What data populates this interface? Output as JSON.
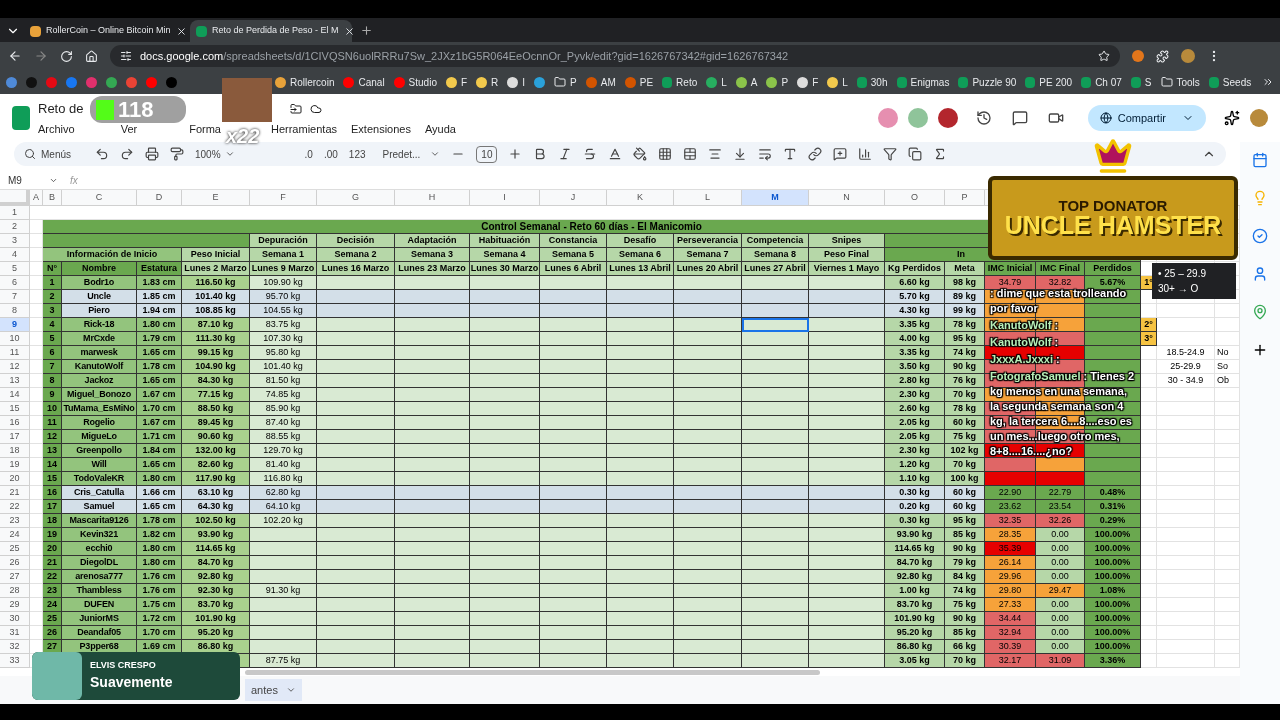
{
  "browser": {
    "tabs": [
      {
        "title": "RollerCoin – Online Bitcoin Min",
        "selected": false
      },
      {
        "title": "Reto de Perdida de Peso - El M",
        "selected": true
      }
    ],
    "url_host": "docs.google.com",
    "url_path": "/spreadsheets/d/1CIVQSN6uolRRRu7Sw_2JXz1bG5R064EeOcnnOr_Pyvk/edit?gid=1626767342#gid=1626767342",
    "bookmarks": [
      {
        "kind": "site",
        "color": "#4f8ad8"
      },
      {
        "kind": "site",
        "color": "#111111"
      },
      {
        "kind": "site",
        "color": "#e50914"
      },
      {
        "kind": "site",
        "color": "#1877f2"
      },
      {
        "kind": "site",
        "color": "#e1306c"
      },
      {
        "kind": "site",
        "color": "#34a853"
      },
      {
        "kind": "site",
        "color": "#ea4335"
      },
      {
        "kind": "site",
        "color": "#ff0000"
      },
      {
        "kind": "site",
        "color": "#000000"
      },
      {
        "kind": "gap"
      },
      {
        "kind": "site",
        "color": "#e8a23a",
        "label": "Rollercoin"
      },
      {
        "kind": "site",
        "color": "#ff0000",
        "label": "Canal"
      },
      {
        "kind": "site",
        "color": "#ff0000",
        "label": "Studio"
      },
      {
        "kind": "site",
        "color": "#f2c94c",
        "label": "F"
      },
      {
        "kind": "site",
        "color": "#f2c94c",
        "label": "R"
      },
      {
        "kind": "site",
        "color": "#dddddd",
        "label": "I"
      },
      {
        "kind": "site",
        "color": "#2aa1da"
      },
      {
        "kind": "folder",
        "label": "P"
      },
      {
        "kind": "site",
        "color": "#d35400",
        "label": "AM"
      },
      {
        "kind": "site",
        "color": "#d35400",
        "label": "PE"
      },
      {
        "kind": "sheet",
        "label": "Reto"
      },
      {
        "kind": "site",
        "color": "#27ae60",
        "label": "L"
      },
      {
        "kind": "site",
        "color": "#8bc34a",
        "label": "A"
      },
      {
        "kind": "site",
        "color": "#8bc34a",
        "label": "P"
      },
      {
        "kind": "site",
        "color": "#dddddd",
        "label": "F"
      },
      {
        "kind": "site",
        "color": "#f2c94c",
        "label": "L"
      },
      {
        "kind": "sheet",
        "label": "30h"
      },
      {
        "kind": "sheet",
        "label": "Enigmas"
      },
      {
        "kind": "sheet",
        "label": "Puzzle 90"
      },
      {
        "kind": "sheet",
        "label": "PE 200"
      },
      {
        "kind": "sheet",
        "label": "Ch 07"
      },
      {
        "kind": "sheet",
        "label": "S"
      },
      {
        "kind": "folder",
        "label": "Tools"
      },
      {
        "kind": "sheet",
        "label": "Seeds"
      }
    ]
  },
  "doc": {
    "title": "Reto de",
    "menu": [
      "Archivo",
      "Ver",
      "Forma",
      "Herramientas",
      "Extensiones",
      "Ayuda"
    ],
    "collaborators": [
      {
        "color": "#e68fb0"
      },
      {
        "color": "#8fc49a"
      },
      {
        "color": "#b3262d"
      }
    ],
    "share": "Compartir"
  },
  "toolbar": {
    "search": "Menús",
    "zoom": "100%",
    "decimals": [
      ".0",
      ".00",
      "123"
    ],
    "font": "Predet...",
    "font_size": "10"
  },
  "formula_bar": {
    "cell": "M9",
    "fx": "fx"
  },
  "columns": [
    {
      "label": "A",
      "selected": false
    },
    {
      "label": "B",
      "selected": false
    },
    {
      "label": "C",
      "selected": false
    },
    {
      "label": "D",
      "selected": false
    },
    {
      "label": "E",
      "selected": false
    },
    {
      "label": "F",
      "selected": false
    },
    {
      "label": "G",
      "selected": false
    },
    {
      "label": "H",
      "selected": false
    },
    {
      "label": "I",
      "selected": false
    },
    {
      "label": "J",
      "selected": false
    },
    {
      "label": "K",
      "selected": false
    },
    {
      "label": "L",
      "selected": false
    },
    {
      "label": "M",
      "selected": true
    },
    {
      "label": "N",
      "selected": false
    },
    {
      "label": "O",
      "selected": false
    },
    {
      "label": "P",
      "selected": false
    }
  ],
  "row_numbers": [
    {
      "label": "1",
      "selected": false
    },
    {
      "label": "2",
      "selected": false
    },
    {
      "label": "3",
      "selected": false
    },
    {
      "label": "4",
      "selected": false
    },
    {
      "label": "5",
      "selected": false
    },
    {
      "label": "6",
      "selected": false
    },
    {
      "label": "7",
      "selected": false
    },
    {
      "label": "8",
      "selected": false
    },
    {
      "label": "9",
      "selected": true
    },
    {
      "label": "10",
      "selected": false
    },
    {
      "label": "11",
      "selected": false
    },
    {
      "label": "12",
      "selected": false
    },
    {
      "label": "13",
      "selected": false
    },
    {
      "label": "14",
      "selected": false
    },
    {
      "label": "15",
      "selected": false
    },
    {
      "label": "16",
      "selected": false
    },
    {
      "label": "17",
      "selected": false
    },
    {
      "label": "18",
      "selected": false
    },
    {
      "label": "19",
      "selected": false
    },
    {
      "label": "20",
      "selected": false
    },
    {
      "label": "21",
      "selected": false
    },
    {
      "label": "22",
      "selected": false
    },
    {
      "label": "23",
      "selected": false
    },
    {
      "label": "24",
      "selected": false
    },
    {
      "label": "25",
      "selected": false
    },
    {
      "label": "26",
      "selected": false
    },
    {
      "label": "27",
      "selected": false
    },
    {
      "label": "28",
      "selected": false
    },
    {
      "label": "29",
      "selected": false
    },
    {
      "label": "30",
      "selected": false
    },
    {
      "label": "31",
      "selected": false
    },
    {
      "label": "32",
      "selected": false
    },
    {
      "label": "33",
      "selected": false
    }
  ],
  "sheet": {
    "title": "Control Semanal - Reto 60 días - El Manicomio",
    "phases": [
      "Depuración",
      "Decisión",
      "Adaptación",
      "Habituación",
      "Constancia",
      "Desafío",
      "Perseverancia",
      "Competencia",
      "Snipes"
    ],
    "start_group": "Información de Inicio",
    "start_weight": "Peso Inicial",
    "weeks": [
      "Semana 1",
      "Semana 2",
      "Semana 3",
      "Semana 4",
      "Semana 5",
      "Semana 6",
      "Semana 7",
      "Semana 8",
      "Peso Final"
    ],
    "final_group": "In",
    "headers": [
      "N°",
      "Nombre",
      "Estatura",
      "Lunes 2 Marzo",
      "Lunes 9 Marzo",
      "Lunes 16 Marzo",
      "Lunes 23 Marzo",
      "Lunes 30 Marzo",
      "Lunes 6 Abril",
      "Lunes 13 Abril",
      "Lunes 20 Abril",
      "Lunes 27 Abril",
      "Viernes 1 Mayo",
      "Kg Perdidos",
      "Meta",
      "IMC Inicial",
      "IMC Final",
      "Perdidos"
    ],
    "participants": [
      {
        "no": "1",
        "name": "Bodr1o",
        "height": "1.83 cm",
        "start": "116.50 kg",
        "week1": "109.90 kg",
        "lost": "6.60 kg",
        "goal": "98 kg",
        "bmi_start": {
          "value": "34.79",
          "color": "#e06666"
        },
        "bmi_end": {
          "value": "32.82",
          "color": "#e06666"
        },
        "percent": {
          "value": "5.67%",
          "color": "#6aa84f"
        },
        "highlighted": false,
        "rank": "1°"
      },
      {
        "no": "2",
        "name": "Uncle",
        "height": "1.85 cm",
        "start": "101.40 kg",
        "week1": "95.70 kg",
        "lost": "5.70 kg",
        "goal": "89 kg",
        "bmi_start": {
          "color": "#f6a23a"
        },
        "bmi_end": {
          "color": "#f6a23a"
        },
        "percent": {
          "color": "#6aa84f"
        },
        "highlighted": true
      },
      {
        "no": "3",
        "name": "Piero",
        "height": "1.94 cm",
        "start": "108.85 kg",
        "week1": "104.55 kg",
        "lost": "4.30 kg",
        "goal": "99 kg",
        "bmi_start": {
          "color": "#f6a23a"
        },
        "bmi_end": {
          "color": "#f6a23a"
        },
        "percent": {
          "color": "#6aa84f"
        },
        "highlighted": true
      },
      {
        "no": "4",
        "name": "Rick-18",
        "height": "1.80 cm",
        "start": "87.10 kg",
        "week1": "83.75 kg",
        "lost": "3.35 kg",
        "goal": "78 kg",
        "bmi_start": {
          "color": "#f6a23a"
        },
        "bmi_end": {
          "color": "#f6a23a"
        },
        "percent": {
          "color": "#6aa84f"
        },
        "highlighted": false,
        "rank": "2°"
      },
      {
        "no": "5",
        "name": "MrCxde",
        "height": "1.79 cm",
        "start": "111.30 kg",
        "week1": "107.30 kg",
        "lost": "4.00 kg",
        "goal": "95 kg",
        "bmi_start": {
          "color": "#e06666"
        },
        "bmi_end": {
          "color": "#e06666"
        },
        "percent": {
          "color": "#6aa84f"
        },
        "highlighted": false,
        "rank": "3°"
      },
      {
        "no": "6",
        "name": "marwesk",
        "height": "1.65 cm",
        "start": "99.15 kg",
        "week1": "95.80 kg",
        "lost": "3.35 kg",
        "goal": "74 kg",
        "bmi_start": {
          "color": "#e60000"
        },
        "bmi_end": {
          "color": "#e60000"
        },
        "percent": {
          "color": "#6aa84f"
        },
        "highlighted": false
      },
      {
        "no": "7",
        "name": "KanutoWolf",
        "height": "1.78 cm",
        "start": "104.90 kg",
        "week1": "101.40 kg",
        "lost": "3.50 kg",
        "goal": "90 kg",
        "bmi_start": {
          "color": "#e06666"
        },
        "bmi_end": {
          "color": "#e06666"
        },
        "percent": {
          "color": "#6aa84f"
        },
        "highlighted": false
      },
      {
        "no": "8",
        "name": "Jackoz",
        "height": "1.65 cm",
        "start": "84.30 kg",
        "week1": "81.50 kg",
        "lost": "2.80 kg",
        "goal": "76 kg",
        "bmi_start": {
          "color": "#e06666"
        },
        "bmi_end": {
          "color": "#e06666"
        },
        "percent": {
          "color": "#6aa84f"
        },
        "highlighted": false
      },
      {
        "no": "9",
        "name": "Miguel_Bonozo",
        "height": "1.67 cm",
        "start": "77.15 kg",
        "week1": "74.85 kg",
        "lost": "2.30 kg",
        "goal": "70 kg",
        "bmi_start": {
          "color": "#f6a23a"
        },
        "bmi_end": {
          "color": "#f6a23a"
        },
        "percent": {
          "color": "#6aa84f"
        },
        "highlighted": false
      },
      {
        "no": "10",
        "name": "TuMama_EsMiNo",
        "height": "1.70 cm",
        "start": "88.50 kg",
        "week1": "85.90 kg",
        "lost": "2.60 kg",
        "goal": "78 kg",
        "bmi_start": {
          "color": "#e06666"
        },
        "bmi_end": {
          "color": "#f6a23a"
        },
        "percent": {
          "color": "#6aa84f"
        },
        "highlighted": false
      },
      {
        "no": "11",
        "name": "Rogelio",
        "height": "1.67 cm",
        "start": "89.45 kg",
        "week1": "87.40 kg",
        "lost": "2.05 kg",
        "goal": "60 kg",
        "bmi_start": {
          "color": "#e06666"
        },
        "bmi_end": {
          "color": "#f6a23a"
        },
        "percent": {
          "color": "#6aa84f"
        },
        "highlighted": false
      },
      {
        "no": "12",
        "name": "MigueLo",
        "height": "1.71 cm",
        "start": "90.60 kg",
        "week1": "88.55 kg",
        "lost": "2.05 kg",
        "goal": "75 kg",
        "bmi_start": {
          "color": "#e06666"
        },
        "bmi_end": {
          "color": "#e06666"
        },
        "percent": {
          "color": "#6aa84f"
        },
        "highlighted": false
      },
      {
        "no": "13",
        "name": "Greenpollo",
        "height": "1.84 cm",
        "start": "132.00 kg",
        "week1": "129.70 kg",
        "lost": "2.30 kg",
        "goal": "102 kg",
        "bmi_start": {
          "color": "#e60000"
        },
        "bmi_end": {
          "color": "#e60000"
        },
        "percent": {
          "color": "#6aa84f"
        },
        "highlighted": false
      },
      {
        "no": "14",
        "name": "Will",
        "height": "1.65 cm",
        "start": "82.60 kg",
        "week1": "81.40 kg",
        "lost": "1.20 kg",
        "goal": "70 kg",
        "bmi_start": {
          "color": "#e06666"
        },
        "bmi_end": {
          "color": "#f6a23a"
        },
        "percent": {
          "color": "#6aa84f"
        },
        "highlighted": false
      },
      {
        "no": "15",
        "name": "TodoValeKR",
        "height": "1.80 cm",
        "start": "117.90 kg",
        "week1": "116.80 kg",
        "lost": "1.10 kg",
        "goal": "100 kg",
        "bmi_start": {
          "color": "#e60000"
        },
        "bmi_end": {
          "color": "#e60000"
        },
        "percent": {
          "color": "#6aa84f"
        },
        "highlighted": false
      },
      {
        "no": "16",
        "name": "Cris_Catulla",
        "height": "1.66 cm",
        "start": "63.10 kg",
        "week1": "62.80 kg",
        "lost": "0.30 kg",
        "goal": "60 kg",
        "bmi_start": {
          "value": "22.90",
          "color": "#6aa84f"
        },
        "bmi_end": {
          "value": "22.79",
          "color": "#6aa84f"
        },
        "percent": {
          "value": "0.48%",
          "color": "#6aa84f"
        },
        "highlighted": true
      },
      {
        "no": "17",
        "name": "Samuel",
        "height": "1.65 cm",
        "start": "64.30 kg",
        "week1": "64.10 kg",
        "lost": "0.20 kg",
        "goal": "60 kg",
        "bmi_start": {
          "value": "23.62",
          "color": "#6aa84f"
        },
        "bmi_end": {
          "value": "23.54",
          "color": "#6aa84f"
        },
        "percent": {
          "value": "0.31%",
          "color": "#6aa84f"
        },
        "highlighted": true
      },
      {
        "no": "18",
        "name": "Mascarita9126",
        "height": "1.78 cm",
        "start": "102.50 kg",
        "week1": "102.20 kg",
        "lost": "0.30 kg",
        "goal": "95 kg",
        "bmi_start": {
          "value": "32.35",
          "color": "#e06666"
        },
        "bmi_end": {
          "value": "32.26",
          "color": "#e06666"
        },
        "percent": {
          "value": "0.29%",
          "color": "#6aa84f"
        },
        "highlighted": false
      },
      {
        "no": "19",
        "name": "Kevin321",
        "height": "1.82 cm",
        "start": "93.90 kg",
        "lost": "93.90 kg",
        "goal": "85 kg",
        "bmi_start": {
          "value": "28.35",
          "color": "#f6a23a"
        },
        "bmi_end": {
          "value": "0.00",
          "color": "#b6d7a8"
        },
        "percent": {
          "value": "100.00%",
          "color": "#6aa84f"
        },
        "highlighted": false
      },
      {
        "no": "20",
        "name": "ecchi0",
        "height": "1.80 cm",
        "start": "114.65 kg",
        "lost": "114.65 kg",
        "goal": "90 kg",
        "bmi_start": {
          "value": "35.39",
          "color": "#e60000"
        },
        "bmi_end": {
          "value": "0.00",
          "color": "#b6d7a8"
        },
        "percent": {
          "value": "100.00%",
          "color": "#6aa84f"
        },
        "highlighted": false
      },
      {
        "no": "21",
        "name": "DiegolDL",
        "height": "1.80 cm",
        "start": "84.70 kg",
        "lost": "84.70 kg",
        "goal": "79 kg",
        "bmi_start": {
          "value": "26.14",
          "color": "#f6a23a"
        },
        "bmi_end": {
          "value": "0.00",
          "color": "#b6d7a8"
        },
        "percent": {
          "value": "100.00%",
          "color": "#6aa84f"
        },
        "highlighted": false
      },
      {
        "no": "22",
        "name": "arenosa777",
        "height": "1.76 cm",
        "start": "92.80 kg",
        "lost": "92.80 kg",
        "goal": "84 kg",
        "bmi_start": {
          "value": "29.96",
          "color": "#f6a23a"
        },
        "bmi_end": {
          "value": "0.00",
          "color": "#b6d7a8"
        },
        "percent": {
          "value": "100.00%",
          "color": "#6aa84f"
        },
        "highlighted": false
      },
      {
        "no": "23",
        "name": "Thambless",
        "height": "1.76 cm",
        "start": "92.30 kg",
        "week1": "91.30 kg",
        "lost": "1.00 kg",
        "goal": "74 kg",
        "bmi_start": {
          "value": "29.80",
          "color": "#f6a23a"
        },
        "bmi_end": {
          "value": "29.47",
          "color": "#f6a23a"
        },
        "percent": {
          "value": "1.08%",
          "color": "#6aa84f"
        },
        "highlighted": false
      },
      {
        "no": "24",
        "name": "DUFEN",
        "height": "1.75 cm",
        "start": "83.70 kg",
        "lost": "83.70 kg",
        "goal": "75 kg",
        "bmi_start": {
          "value": "27.33",
          "color": "#f6a23a"
        },
        "bmi_end": {
          "value": "0.00",
          "color": "#b6d7a8"
        },
        "percent": {
          "value": "100.00%",
          "color": "#6aa84f"
        },
        "highlighted": false
      },
      {
        "no": "25",
        "name": "JuniorMS",
        "height": "1.72 cm",
        "start": "101.90 kg",
        "lost": "101.90 kg",
        "goal": "90 kg",
        "bmi_start": {
          "value": "34.44",
          "color": "#e06666"
        },
        "bmi_end": {
          "value": "0.00",
          "color": "#b6d7a8"
        },
        "percent": {
          "value": "100.00%",
          "color": "#6aa84f"
        },
        "highlighted": false
      },
      {
        "no": "26",
        "name": "Deandaf05",
        "height": "1.70 cm",
        "start": "95.20 kg",
        "lost": "95.20 kg",
        "goal": "85 kg",
        "bmi_start": {
          "value": "32.94",
          "color": "#e06666"
        },
        "bmi_end": {
          "value": "0.00",
          "color": "#b6d7a8"
        },
        "percent": {
          "value": "100.00%",
          "color": "#6aa84f"
        },
        "highlighted": false
      },
      {
        "no": "27",
        "name": "P3pper68",
        "height": "1.69 cm",
        "start": "86.80 kg",
        "lost": "86.80 kg",
        "goal": "66 kg",
        "bmi_start": {
          "value": "30.39",
          "color": "#e06666"
        },
        "bmi_end": {
          "value": "0.00",
          "color": "#b6d7a8"
        },
        "percent": {
          "value": "100.00%",
          "color": "#6aa84f"
        },
        "highlighted": false
      },
      {
        "week1": "87.75 kg",
        "lost": "3.05 kg",
        "goal": "70 kg",
        "bmi_start": {
          "value": "32.17",
          "color": "#e06666"
        },
        "bmi_end": {
          "value": "31.09",
          "color": "#e06666"
        },
        "percent": {
          "value": "3.36%",
          "color": "#6aa84f"
        },
        "highlighted": false
      }
    ],
    "bmi_ranges": [
      {
        "range": "18.5-24.9",
        "label": "No"
      },
      {
        "range": "25-29.9",
        "label": "So"
      },
      {
        "range": "30 - 34.9",
        "label": "Ob"
      }
    ],
    "note_lines": [
      "•  25 – 29.9",
      "30+ → O"
    ]
  },
  "sheet_tab": "antes",
  "overlays": {
    "kick_count": "118",
    "emote_multiplier": "x22",
    "donator_heading": "TOP DONATOR",
    "donator_name": "UNCLE HAMSTER",
    "chat": [
      {
        "text": ": dime que esta trolleando por favor"
      },
      {
        "author": "KanutoWolf",
        "text": ":"
      },
      {
        "author": "KanutoWolf",
        "text": ":"
      },
      {
        "author": "JxxxA.Jxxxi",
        "text": ":"
      },
      {
        "author": "FotografoSamuel",
        "text": ": Tienes 2 kg menos en una semana, la segunda semana son 4 kg, la tercera 6....8....eso es un mes...luego otro mes, 8+8....16....¿no?"
      }
    ],
    "song_artist": "ELVIS CRESPO",
    "song_title": "Suavemente"
  }
}
